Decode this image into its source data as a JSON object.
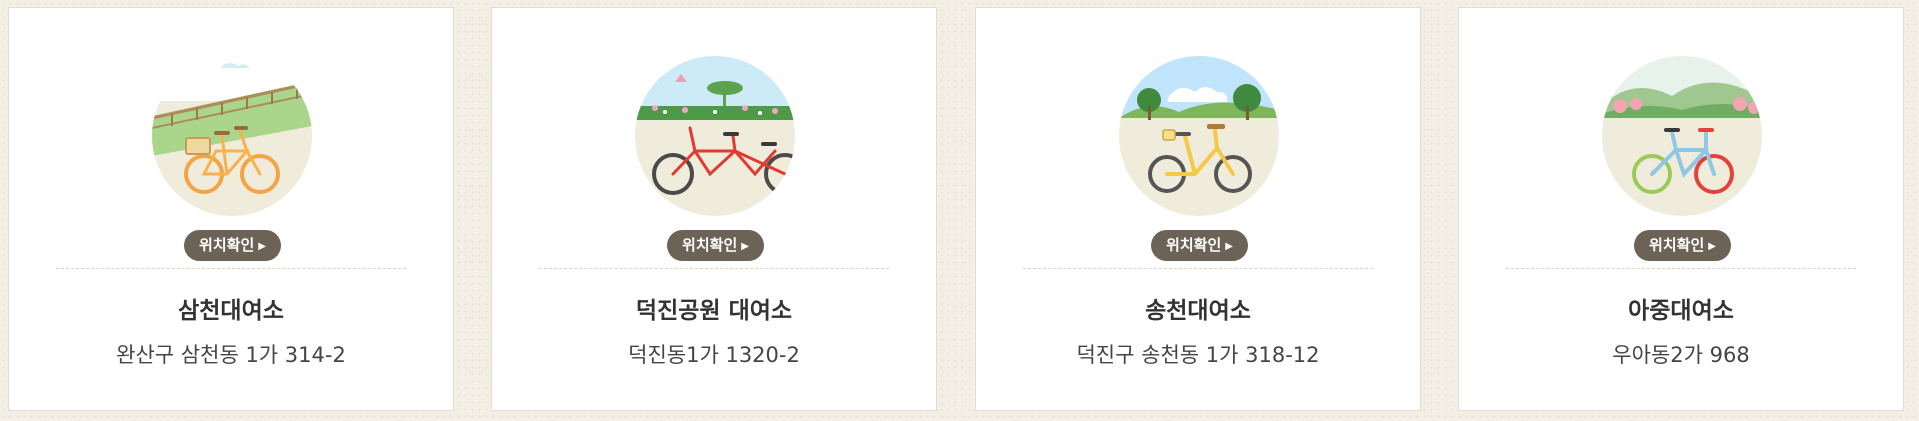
{
  "stations": [
    {
      "name": "삼천대여소",
      "address": "완산구 삼천동 1가 314-2",
      "button_label": "위치확인",
      "illustration": "orange-bicycle-by-river-railing"
    },
    {
      "name": "덕진공원 대여소",
      "address": "덕진동1가 1320-2",
      "button_label": "위치확인",
      "illustration": "red-tandem-bicycle-lotus-park"
    },
    {
      "name": "송천대여소",
      "address": "덕진구 송천동 1가 318-12",
      "button_label": "위치확인",
      "illustration": "yellow-bicycle-trees-sky"
    },
    {
      "name": "아중대여소",
      "address": "우아동2가 968",
      "button_label": "위치확인",
      "illustration": "blue-bicycle-hills-blossoms"
    }
  ],
  "icons": {
    "button_arrow": "play-arrow-icon"
  },
  "colors": {
    "button_bg": "#6d6256",
    "circle_bg": "#f0ecdc",
    "page_bg": "#f3efe4"
  }
}
